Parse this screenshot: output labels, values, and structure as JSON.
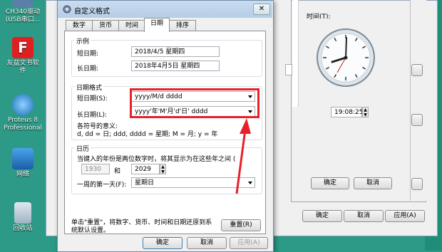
{
  "desktop": {
    "icons": [
      {
        "label_line1": "CH340驱动",
        "label_line2": "(USB串口..."
      },
      {
        "label_line1": "友益文书软",
        "label_line2": "件"
      },
      {
        "label_line1": "Proteus 8",
        "label_line2": "Professional"
      },
      {
        "label_line1": "网络",
        "label_line2": ""
      },
      {
        "label_line1": "回收站",
        "label_line2": ""
      }
    ]
  },
  "dialog": {
    "title": "自定义格式",
    "tabs": [
      "数字",
      "货币",
      "时间",
      "日期",
      "排序"
    ],
    "active_tab": "日期",
    "example_group": "示例",
    "short_date_label": "短日期:",
    "short_date_value": "2018/4/5 星期四",
    "long_date_label": "长日期:",
    "long_date_value": "2018年4月5日 星期四",
    "format_group": "日期格式",
    "short_date_format_label": "短日期(S):",
    "short_date_format_value": "yyyy/M/d dddd",
    "long_date_format_label": "长日期(L):",
    "long_date_format_value": "yyyy'年'M'月'd'日' dddd",
    "symbols_title": "各符号的意义:",
    "symbols_text": "d, dd = 日;  ddd, dddd = 星期;  M = 月;  y = 年",
    "calendar_group": "日历",
    "calendar_text": "当键入的年份是两位数字时，将其显示为在这些年之间 (",
    "year_from": "1930",
    "and_label": "和",
    "year_to": "2029",
    "first_day_label": "一周的第一天(F):",
    "first_day_value": "星期日",
    "reset_hint_line1": "单击\"重置\"，将数字、货币、时间和日期还原到系",
    "reset_hint_line2": "统默认设置。",
    "reset_button": "重置(R)",
    "ok_button": "确定",
    "cancel_button": "取消",
    "apply_button": "应用(A)"
  },
  "time_window": {
    "time_label": "时间(T):",
    "time_value": "19:08:25",
    "ok_button": "确定",
    "cancel_button": "取消"
  },
  "outer_window": {
    "ok_button": "确定",
    "cancel_button": "取消",
    "apply_button": "应用(A)"
  },
  "colors": {
    "highlight_red": "#e8202a",
    "desktop_bg": "#2c9a86"
  }
}
